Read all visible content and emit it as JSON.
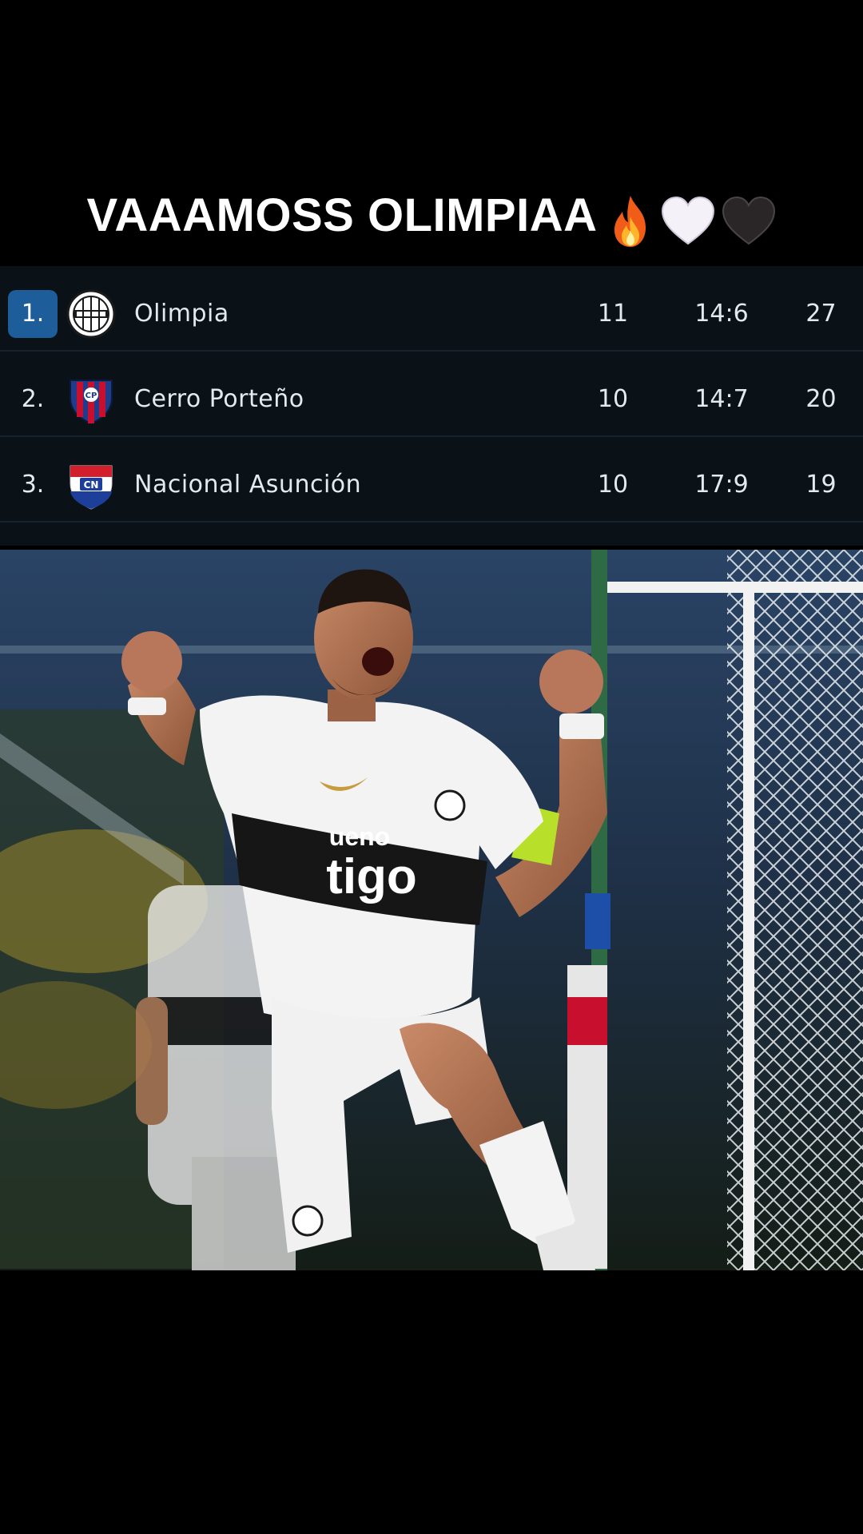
{
  "caption": {
    "text": "VAAAMOSS OLIMPIAA",
    "emojis": [
      "fire-icon",
      "white-heart-icon",
      "black-heart-icon"
    ]
  },
  "standings": {
    "rows": [
      {
        "position": "1.",
        "team": "Olimpia",
        "played": "11",
        "goals": "14:6",
        "points": "27",
        "highlight": true,
        "crest": "olimpia-crest-icon"
      },
      {
        "position": "2.",
        "team": "Cerro Porteño",
        "played": "10",
        "goals": "14:7",
        "points": "20",
        "highlight": false,
        "crest": "cerro-porteno-crest-icon"
      },
      {
        "position": "3.",
        "team": "Nacional Asunción",
        "played": "10",
        "goals": "17:9",
        "points": "19",
        "highlight": false,
        "crest": "nacional-asuncion-crest-icon"
      }
    ],
    "colors": {
      "background": "#0b1217",
      "highlight": "#1d5d9a",
      "text": "#e4e9ed"
    }
  },
  "photo": {
    "jersey_sponsors": [
      "ueno",
      "tigo"
    ]
  }
}
